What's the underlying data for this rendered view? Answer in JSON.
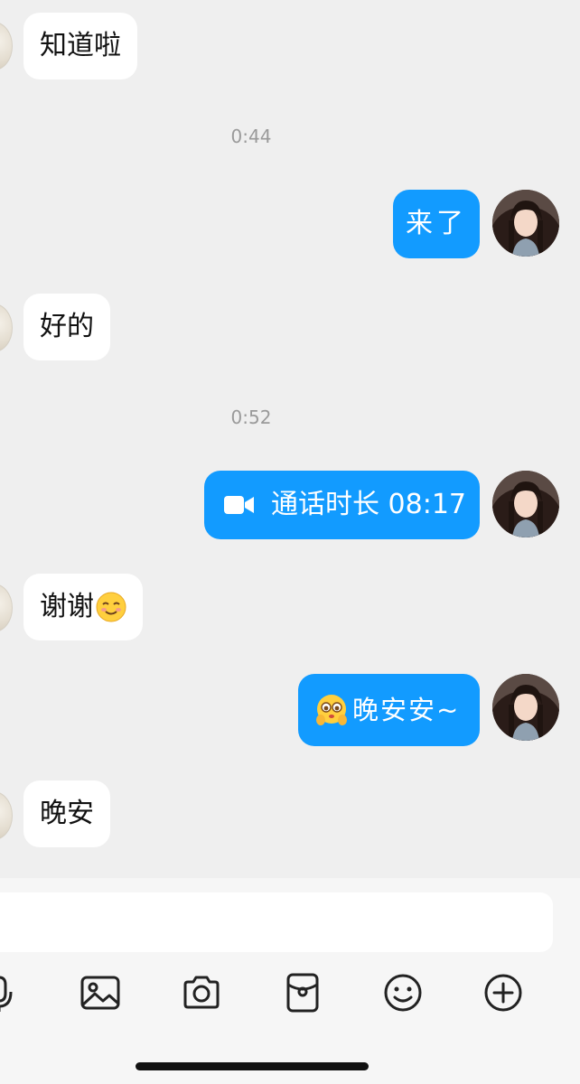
{
  "conversation": {
    "messages": [
      {
        "side": "in",
        "text": "知道啦"
      },
      {
        "side": "time",
        "text": "0:44"
      },
      {
        "side": "out",
        "text": "来了"
      },
      {
        "side": "in",
        "text": "好的"
      },
      {
        "side": "time",
        "text": "0:52"
      },
      {
        "side": "out",
        "type": "call",
        "text": "通话时长 08:17"
      },
      {
        "side": "in",
        "text": "谢谢",
        "emoji": "smiling-face-emoji"
      },
      {
        "side": "out",
        "text": "晚安安~",
        "emoji": "pleading-face-hands-emoji"
      },
      {
        "side": "in",
        "text": "晚安"
      }
    ]
  },
  "toolbar": {
    "icons": [
      "microphone-icon",
      "image-icon",
      "camera-icon",
      "red-packet-icon",
      "emoji-icon",
      "plus-icon"
    ]
  },
  "colors": {
    "background": "#efefef",
    "incoming_bubble": "#ffffff",
    "outgoing_bubble": "#129bff",
    "timestamp": "#9a9a9a"
  }
}
